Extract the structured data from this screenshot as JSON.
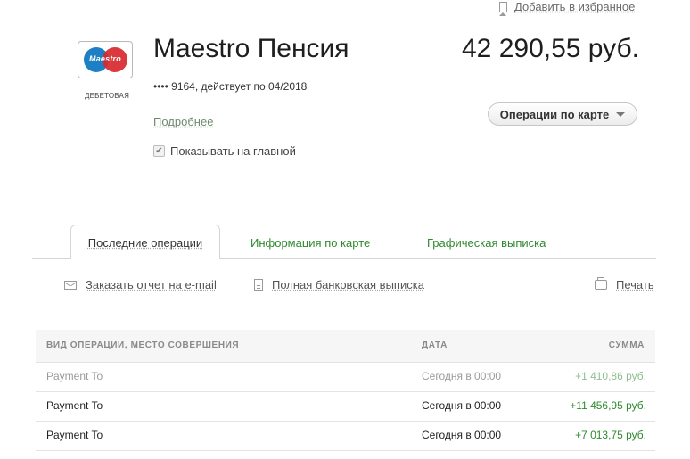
{
  "header": {
    "favorites_label": "Добавить в избранное"
  },
  "card": {
    "brand": "Maestro",
    "type_label": "ДЕБЕТОВАЯ",
    "title": "Maestro Пенсия",
    "masked_number": "•••• 9164, действует по 04/2018",
    "more_link": "Подробнее",
    "show_on_main_label": "Показывать на главной",
    "show_on_main_checked": true,
    "balance": "42 290,55 руб.",
    "ops_button_label": "Операции по карте"
  },
  "tabs": [
    {
      "label": "Последние операции",
      "active": true
    },
    {
      "label": "Информация по карте",
      "active": false
    },
    {
      "label": "Графическая выписка",
      "active": false
    }
  ],
  "actions": {
    "email_report": "Заказать отчет на e-mail",
    "full_statement": "Полная банковская выписка",
    "print": "Печать"
  },
  "table": {
    "headers": [
      "ВИД ОПЕРАЦИИ, МЕСТО СОВЕРШЕНИЯ",
      "ДАТА",
      "СУММА"
    ],
    "rows": [
      {
        "description": "Payment To",
        "date": "Сегодня в 00:00",
        "amount": "+1 410,86 руб."
      },
      {
        "description": "Payment To",
        "date": "Сегодня в 00:00",
        "amount": "+11 456,95 руб."
      },
      {
        "description": "Payment To",
        "date": "Сегодня в 00:00",
        "amount": "+7 013,75 руб."
      }
    ]
  },
  "colors": {
    "accent_green": "#2f8a2f",
    "maestro_blue": "#1d7fc4",
    "maestro_red": "#d7282c"
  }
}
